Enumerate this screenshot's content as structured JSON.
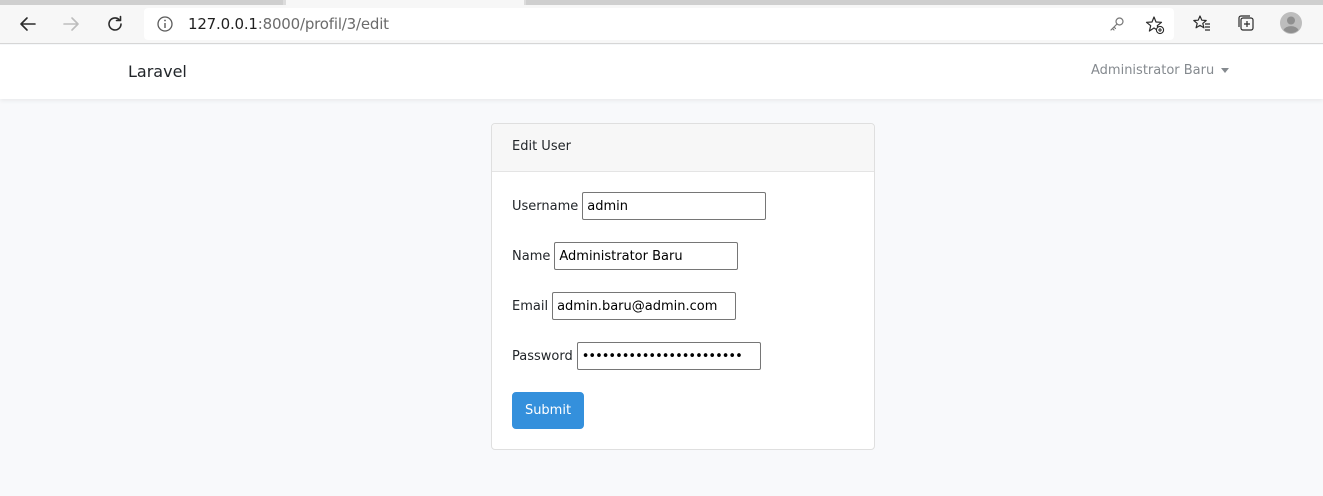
{
  "browser": {
    "url_host": "127.0.0.1",
    "url_path": ":8000/profil/3/edit",
    "icons": [
      "back-arrow-icon",
      "forward-arrow-icon",
      "reload-icon",
      "site-info-icon",
      "key-icon",
      "add-favorite-icon",
      "favorites-icon",
      "collections-icon",
      "profile-avatar-icon"
    ]
  },
  "navbar": {
    "brand": "Laravel",
    "user_name": "Administrator Baru"
  },
  "card": {
    "title": "Edit User",
    "fields": {
      "username": {
        "label": "Username",
        "value": "admin"
      },
      "name": {
        "label": "Name",
        "value": "Administrator Baru"
      },
      "email": {
        "label": "Email",
        "value": "admin.baru@admin.com"
      },
      "password": {
        "label": "Password",
        "value": "••••••••••••••••••••••••"
      }
    },
    "submit_label": "Submit"
  },
  "colors": {
    "primary": "#3490dc",
    "page_bg": "#f8f9fb",
    "navbar_bg": "#ffffff",
    "muted_text": "#858a8f"
  }
}
